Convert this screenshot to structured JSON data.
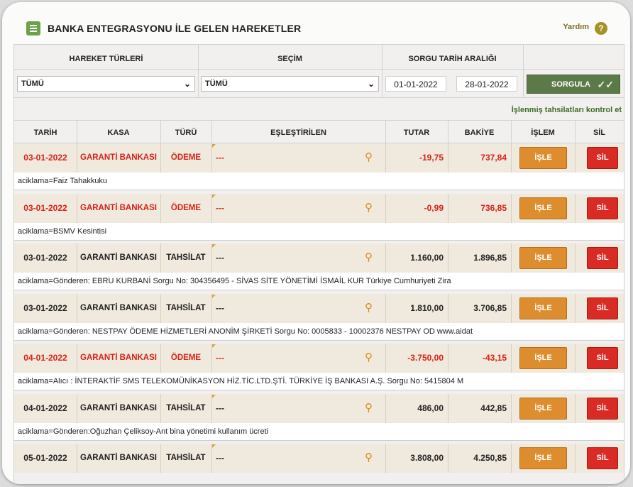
{
  "header": {
    "title": "BANKA ENTEGRASYONU İLE GELEN HAREKETLER",
    "help_label": "Yardım",
    "help_icon": "question-icon"
  },
  "filters": {
    "headers": [
      "HAREKET TÜRLERİ",
      "SEÇİM",
      "SORGU TARİH ARALIĞI"
    ],
    "hareket_turleri": "TÜMÜ",
    "secim": "TÜMÜ",
    "date_from": "01-01-2022",
    "date_to": "28-01-2022",
    "sorgula_label": "SORGULA",
    "kontrol_link": "İşlenmiş tahsilatları kontrol et"
  },
  "table": {
    "columns": [
      "TARİH",
      "KASA",
      "TÜRÜ",
      "EŞLEŞTİRİLEN",
      "TUTAR",
      "BAKİYE",
      "İŞLEM",
      "SİL"
    ],
    "isle_label": "İŞLE",
    "sil_label": "SİL",
    "rows": [
      {
        "tarih": "03-01-2022",
        "kasa": "GARANTİ BANKASI",
        "turu": "ÖDEME",
        "eslestirilen": "---",
        "tutar": "-19,75",
        "bakiye": "737,84",
        "aciklama": "aciklama=Faiz Tahakkuku",
        "color": "red"
      },
      {
        "tarih": "03-01-2022",
        "kasa": "GARANTİ BANKASI",
        "turu": "ÖDEME",
        "eslestirilen": "---",
        "tutar": "-0,99",
        "bakiye": "736,85",
        "aciklama": "aciklama=BSMV Kesintisi",
        "color": "red"
      },
      {
        "tarih": "03-01-2022",
        "kasa": "GARANTİ BANKASI",
        "turu": "TAHSİLAT",
        "eslestirilen": "---",
        "tutar": "1.160,00",
        "bakiye": "1.896,85",
        "aciklama": "aciklama=Gönderen: EBRU KURBANİ Sorgu No: 304356495 - SİVAS SİTE YÖNETİMİ İSMAİL KUR Türkiye Cumhuriyeti Zira",
        "color": "black"
      },
      {
        "tarih": "03-01-2022",
        "kasa": "GARANTİ BANKASI",
        "turu": "TAHSİLAT",
        "eslestirilen": "---",
        "tutar": "1.810,00",
        "bakiye": "3.706,85",
        "aciklama": "aciklama=Gönderen: NESTPAY ÖDEME HİZMETLERİ ANONİM ŞİRKETİ Sorgu No: 0005833 - 10002376 NESTPAY OD www.aidat",
        "color": "black"
      },
      {
        "tarih": "04-01-2022",
        "kasa": "GARANTİ BANKASI",
        "turu": "ÖDEME",
        "eslestirilen": "---",
        "tutar": "-3.750,00",
        "bakiye": "-43,15",
        "aciklama": "aciklama=Alıcı : İNTERAKTİF SMS TELEKOMÜNİKASYON HİZ.TİC.LTD.ŞTİ. TÜRKİYE İŞ BANKASI A.Ş. Sorgu No: 5415804 M",
        "color": "red"
      },
      {
        "tarih": "04-01-2022",
        "kasa": "GARANTİ BANKASI",
        "turu": "TAHSİLAT",
        "eslestirilen": "---",
        "tutar": "486,00",
        "bakiye": "442,85",
        "aciklama": "aciklama=Gönderen:Oğuzhan Çeliksoy-Ant bina yönetimi kullanım ücreti",
        "color": "black"
      },
      {
        "tarih": "05-01-2022",
        "kasa": "GARANTİ BANKASI",
        "turu": "TAHSİLAT",
        "eslestirilen": "---",
        "tutar": "3.808,00",
        "bakiye": "4.250,85",
        "aciklama": "",
        "color": "black"
      }
    ]
  }
}
